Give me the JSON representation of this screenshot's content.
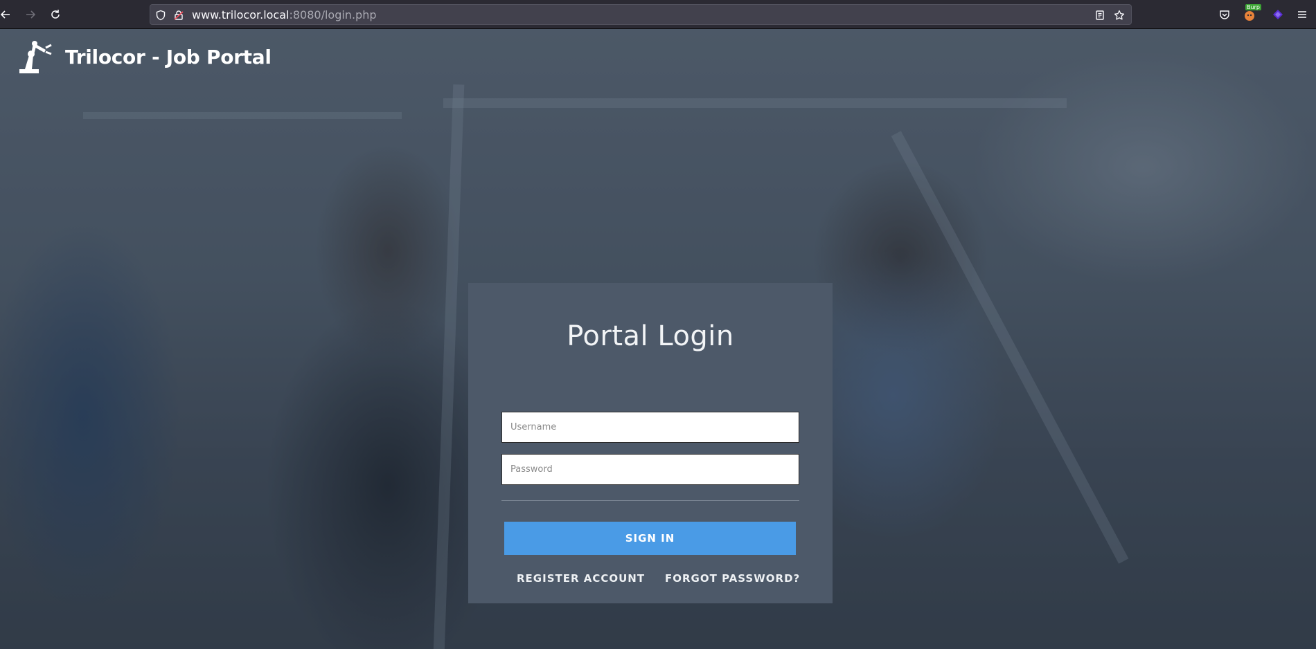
{
  "browser": {
    "url_host": "www.trilocor.local",
    "url_rest": ":8080/login.php",
    "extension_badge": "Burp",
    "icons": [
      "back-arrow-icon",
      "forward-arrow-icon",
      "reload-icon",
      "shield-icon",
      "insecure-lock-icon",
      "reader-view-icon",
      "bookmark-star-icon",
      "pocket-icon",
      "burp-extension-icon",
      "purple-extension-icon",
      "hamburger-menu-icon"
    ]
  },
  "header": {
    "title": "Trilocor - Job Portal",
    "logo_icon": "robot-arm-icon"
  },
  "login": {
    "title": "Portal Login",
    "username_placeholder": "Username",
    "password_placeholder": "Password",
    "signin_label": "SIGN IN",
    "register_label": "REGISTER ACCOUNT",
    "forgot_label": "FORGOT PASSWORD?"
  },
  "colors": {
    "card": "#4d5969",
    "button": "#4a9be6",
    "toolbar": "#2b2a33"
  }
}
